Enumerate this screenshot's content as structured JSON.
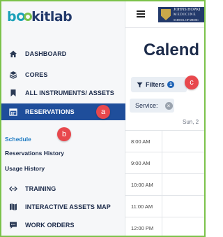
{
  "brand": {
    "logo_prefix": "b",
    "logo_suffix": "kitlab"
  },
  "institution": {
    "line1": "JOHNS HOPKI",
    "line2": "MEDICINE",
    "line3": "SCHOOL OF MEDIC"
  },
  "sidebar": {
    "items": [
      {
        "label": "DASHBOARD",
        "icon": "home-icon"
      },
      {
        "label": "CORES",
        "icon": "layers-icon"
      },
      {
        "label": "ALL INSTRUMENTS/ ASSETS",
        "icon": "bookmark-icon"
      },
      {
        "label": "RESERVATIONS",
        "icon": "calendar-icon",
        "active": true
      }
    ],
    "sub_items": [
      {
        "label": "Schedule",
        "current": true
      },
      {
        "label": "Reservations History"
      },
      {
        "label": "Usage History"
      }
    ],
    "more_items": [
      {
        "label": "TRAINING",
        "icon": "arrows-icon"
      },
      {
        "label": "INTERACTIVE ASSETS MAP",
        "icon": "map-icon"
      },
      {
        "label": "WORK ORDERS",
        "icon": "chat-icon"
      }
    ]
  },
  "callouts": {
    "a": "a",
    "b": "b",
    "c": "c"
  },
  "main": {
    "title": "Calend",
    "filters_label": "Filters",
    "filters_count": "1",
    "service_chip": "Service:",
    "day_header": "Sun, 2",
    "times": [
      "8:00 AM",
      "9:00 AM",
      "10:00 AM",
      "11:00 AM",
      "12:00 PM"
    ]
  },
  "colors": {
    "accent": "#1f4e9b",
    "frame": "#7bc24a",
    "badge": "#e8484d",
    "link": "#1e7bc2"
  }
}
